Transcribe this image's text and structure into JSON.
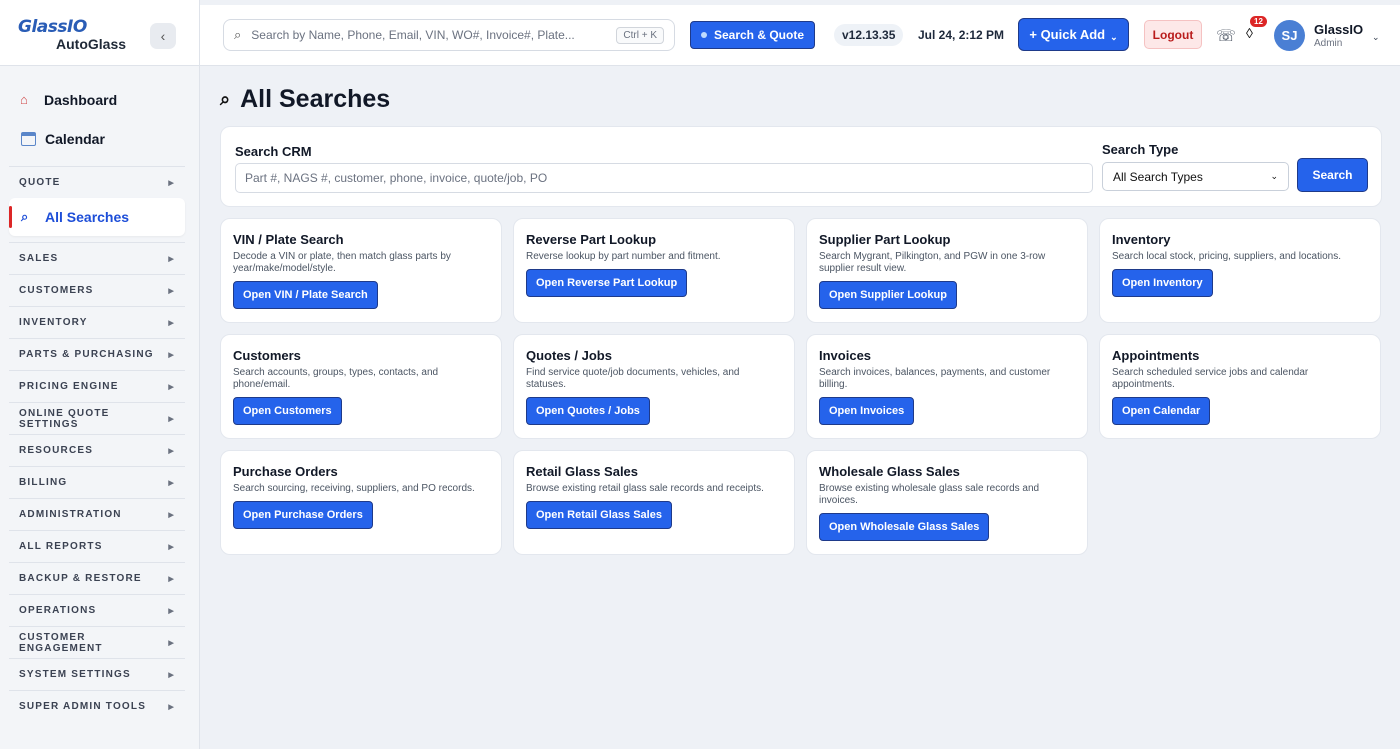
{
  "brand": {
    "line1": "GlassIO",
    "line2": "AutoGlass",
    "collapse_icon": "chevron-left-icon"
  },
  "sidebar": {
    "top_items": [
      {
        "label": "Dashboard",
        "icon": "home-icon"
      },
      {
        "label": "Calendar",
        "icon": "calendar-icon"
      }
    ],
    "quote_section": "QUOTE",
    "active_item": {
      "label": "All Searches",
      "icon": "search-icon"
    },
    "sections": [
      "SALES",
      "CUSTOMERS",
      "INVENTORY",
      "PARTS & PURCHASING",
      "PRICING ENGINE",
      "ONLINE QUOTE SETTINGS",
      "RESOURCES",
      "BILLING",
      "ADMINISTRATION",
      "ALL REPORTS",
      "BACKUP & RESTORE",
      "OPERATIONS",
      "CUSTOMER ENGAGEMENT",
      "SYSTEM SETTINGS",
      "SUPER ADMIN TOOLS"
    ]
  },
  "header": {
    "search_placeholder": "Search by Name, Phone, Email, VIN, WO#, Invoice#, Plate...",
    "shortcut": "Ctrl + K",
    "search_quote_label": "Search & Quote",
    "version": "v12.13.35",
    "datetime": "Jul 24, 2:12 PM",
    "quick_add_label": "+ Quick Add",
    "logout_label": "Logout",
    "notification_count": "12",
    "user": {
      "initials": "SJ",
      "name": "GlassIO",
      "role": "Admin"
    }
  },
  "page": {
    "title": "All Searches"
  },
  "crm": {
    "label": "Search CRM",
    "placeholder": "Part #, NAGS #, customer, phone, invoice, quote/job, PO",
    "type_label": "Search Type",
    "type_selected": "All Search Types",
    "search_button": "Search"
  },
  "cards": [
    {
      "title": "VIN / Plate Search",
      "desc": "Decode a VIN or plate, then match glass parts by year/make/model/style.",
      "button": "Open VIN / Plate Search"
    },
    {
      "title": "Reverse Part Lookup",
      "desc": "Reverse lookup by part number and fitment.",
      "button": "Open Reverse Part Lookup"
    },
    {
      "title": "Supplier Part Lookup",
      "desc": "Search Mygrant, Pilkington, and PGW in one 3-row supplier result view.",
      "button": "Open Supplier Lookup"
    },
    {
      "title": "Inventory",
      "desc": "Search local stock, pricing, suppliers, and locations.",
      "button": "Open Inventory"
    },
    {
      "title": "Customers",
      "desc": "Search accounts, groups, types, contacts, and phone/email.",
      "button": "Open Customers"
    },
    {
      "title": "Quotes / Jobs",
      "desc": "Find service quote/job documents, vehicles, and statuses.",
      "button": "Open Quotes / Jobs"
    },
    {
      "title": "Invoices",
      "desc": "Search invoices, balances, payments, and customer billing.",
      "button": "Open Invoices"
    },
    {
      "title": "Appointments",
      "desc": "Search scheduled service jobs and calendar appointments.",
      "button": "Open Calendar"
    },
    {
      "title": "Purchase Orders",
      "desc": "Search sourcing, receiving, suppliers, and PO records.",
      "button": "Open Purchase Orders"
    },
    {
      "title": "Retail Glass Sales",
      "desc": "Browse existing retail glass sale records and receipts.",
      "button": "Open Retail Glass Sales"
    },
    {
      "title": "Wholesale Glass Sales",
      "desc": "Browse existing wholesale glass sale records and invoices.",
      "button": "Open Wholesale Glass Sales"
    }
  ],
  "colors": {
    "accent": "#2563eb",
    "accent_border": "#1e3a8a",
    "danger": "#dc2626",
    "background": "#eef1f6"
  }
}
